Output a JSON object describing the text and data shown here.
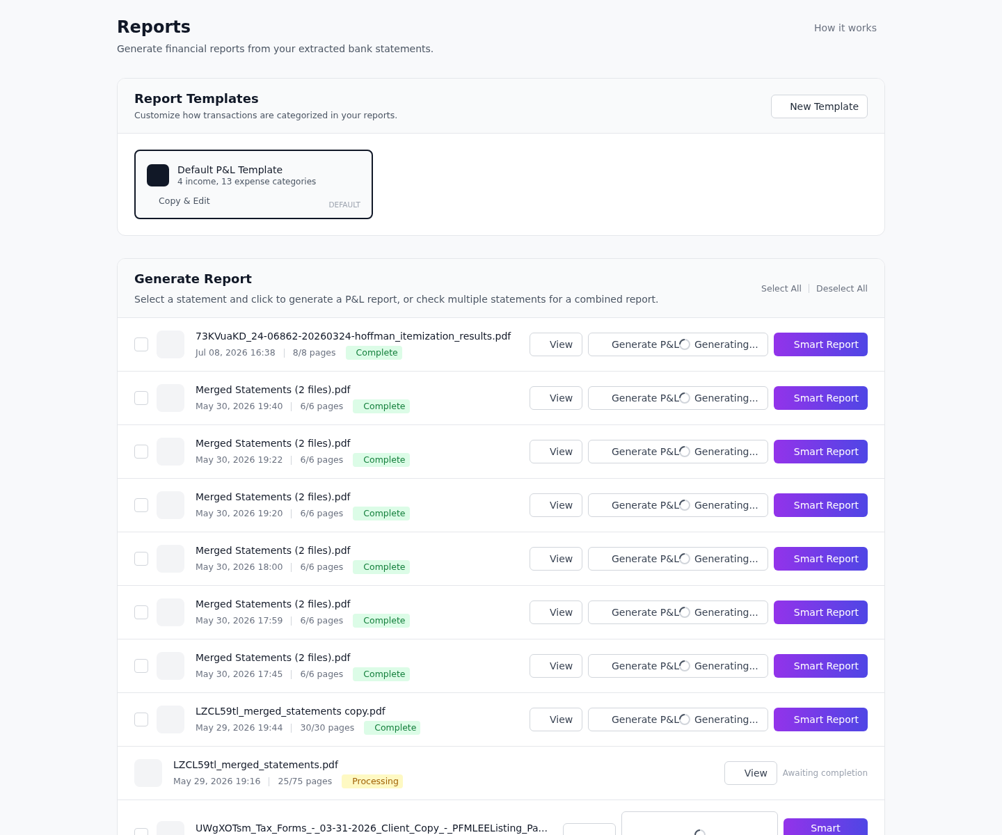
{
  "page": {
    "title": "Reports",
    "subtitle": "Generate financial reports from your extracted bank statements.",
    "help_link": "How it works"
  },
  "templates": {
    "title": "Report Templates",
    "subtitle": "Customize how transactions are categorized in your reports.",
    "new_button": "New Template",
    "items": [
      {
        "name": "Default P&L Template",
        "summary": "4 income, 13 expense categories",
        "action": "Copy & Edit",
        "badge": "DEFAULT",
        "selected": true
      }
    ]
  },
  "generate": {
    "title": "Generate Report",
    "description": "Select a statement and click to generate a P&L report, or check multiple statements for a combined report.",
    "select_all": "Select All",
    "deselect_all": "Deselect All",
    "statements": [
      {
        "kind": "ready",
        "checked": false,
        "name": "73KVuaKD_24-06862-20260324-hoffman_itemization_results.pdf",
        "date": "Jul 08, 2026 16:38",
        "pages": "8/8 pages",
        "status": {
          "kind": "complete",
          "label": "Complete"
        },
        "buttons": [
          {
            "kind": "view",
            "label": "View"
          },
          {
            "kind": "generate",
            "label": "Generate P&L",
            "generating": true,
            "progress_label": "Generating..."
          },
          {
            "kind": "smart",
            "label": "Smart Report"
          }
        ]
      },
      {
        "kind": "ready",
        "checked": false,
        "name": "Merged Statements (2 files).pdf",
        "date": "May 30, 2026 19:40",
        "pages": "6/6 pages",
        "status": {
          "kind": "complete",
          "label": "Complete"
        },
        "buttons": [
          {
            "kind": "view",
            "label": "View"
          },
          {
            "kind": "generate",
            "label": "Generate P&L",
            "generating": true,
            "progress_label": "Generating..."
          },
          {
            "kind": "smart",
            "label": "Smart Report"
          }
        ]
      },
      {
        "kind": "ready",
        "checked": false,
        "name": "Merged Statements (2 files).pdf",
        "date": "May 30, 2026 19:22",
        "pages": "6/6 pages",
        "status": {
          "kind": "complete",
          "label": "Complete"
        },
        "buttons": [
          {
            "kind": "view",
            "label": "View"
          },
          {
            "kind": "generate",
            "label": "Generate P&L",
            "generating": true,
            "progress_label": "Generating..."
          },
          {
            "kind": "smart",
            "label": "Smart Report"
          }
        ]
      },
      {
        "kind": "ready",
        "checked": false,
        "name": "Merged Statements (2 files).pdf",
        "date": "May 30, 2026 19:20",
        "pages": "6/6 pages",
        "status": {
          "kind": "complete",
          "label": "Complete"
        },
        "buttons": [
          {
            "kind": "view",
            "label": "View"
          },
          {
            "kind": "generate",
            "label": "Generate P&L",
            "generating": true,
            "progress_label": "Generating..."
          },
          {
            "kind": "smart",
            "label": "Smart Report"
          }
        ]
      },
      {
        "kind": "ready",
        "checked": false,
        "name": "Merged Statements (2 files).pdf",
        "date": "May 30, 2026 18:00",
        "pages": "6/6 pages",
        "status": {
          "kind": "complete",
          "label": "Complete"
        },
        "buttons": [
          {
            "kind": "view",
            "label": "View"
          },
          {
            "kind": "generate",
            "label": "Generate P&L",
            "generating": true,
            "progress_label": "Generating..."
          },
          {
            "kind": "smart",
            "label": "Smart Report"
          }
        ]
      },
      {
        "kind": "ready",
        "checked": false,
        "name": "Merged Statements (2 files).pdf",
        "date": "May 30, 2026 17:59",
        "pages": "6/6 pages",
        "status": {
          "kind": "complete",
          "label": "Complete"
        },
        "buttons": [
          {
            "kind": "view",
            "label": "View"
          },
          {
            "kind": "generate",
            "label": "Generate P&L",
            "generating": true,
            "progress_label": "Generating..."
          },
          {
            "kind": "smart",
            "label": "Smart Report"
          }
        ]
      },
      {
        "kind": "ready",
        "checked": false,
        "name": "Merged Statements (2 files).pdf",
        "date": "May 30, 2026 17:45",
        "pages": "6/6 pages",
        "status": {
          "kind": "complete",
          "label": "Complete"
        },
        "buttons": [
          {
            "kind": "view",
            "label": "View"
          },
          {
            "kind": "generate",
            "label": "Generate P&L",
            "generating": true,
            "progress_label": "Generating..."
          },
          {
            "kind": "smart",
            "label": "Smart Report"
          }
        ]
      },
      {
        "kind": "ready",
        "checked": false,
        "name": "LZCL59tl_merged_statements copy.pdf",
        "date": "May 29, 2026 19:44",
        "pages": "30/30 pages",
        "status": {
          "kind": "complete",
          "label": "Complete"
        },
        "buttons": [
          {
            "kind": "view",
            "label": "View"
          },
          {
            "kind": "generate",
            "label": "Generate P&L",
            "generating": true,
            "progress_label": "Generating..."
          },
          {
            "kind": "smart",
            "label": "Smart Report"
          }
        ]
      },
      {
        "kind": "pending",
        "name": "LZCL59tl_merged_statements.pdf",
        "date": "May 29, 2026 19:16",
        "pages": "25/75 pages",
        "status": {
          "kind": "processing",
          "label": "Processing"
        },
        "buttons": [
          {
            "kind": "view",
            "label": "View"
          }
        ],
        "note": "Awaiting completion"
      },
      {
        "kind": "ready",
        "checked": false,
        "name": "UWgXOTsm_Tax_Forms_-_03-31-2026_Client_Copy_-_PFMLEEListing_Pa...",
        "buttons": [
          {
            "kind": "view"
          },
          {
            "kind": "generate",
            "generating": true
          },
          {
            "kind": "smart",
            "label": "Smart"
          }
        ]
      }
    ]
  }
}
